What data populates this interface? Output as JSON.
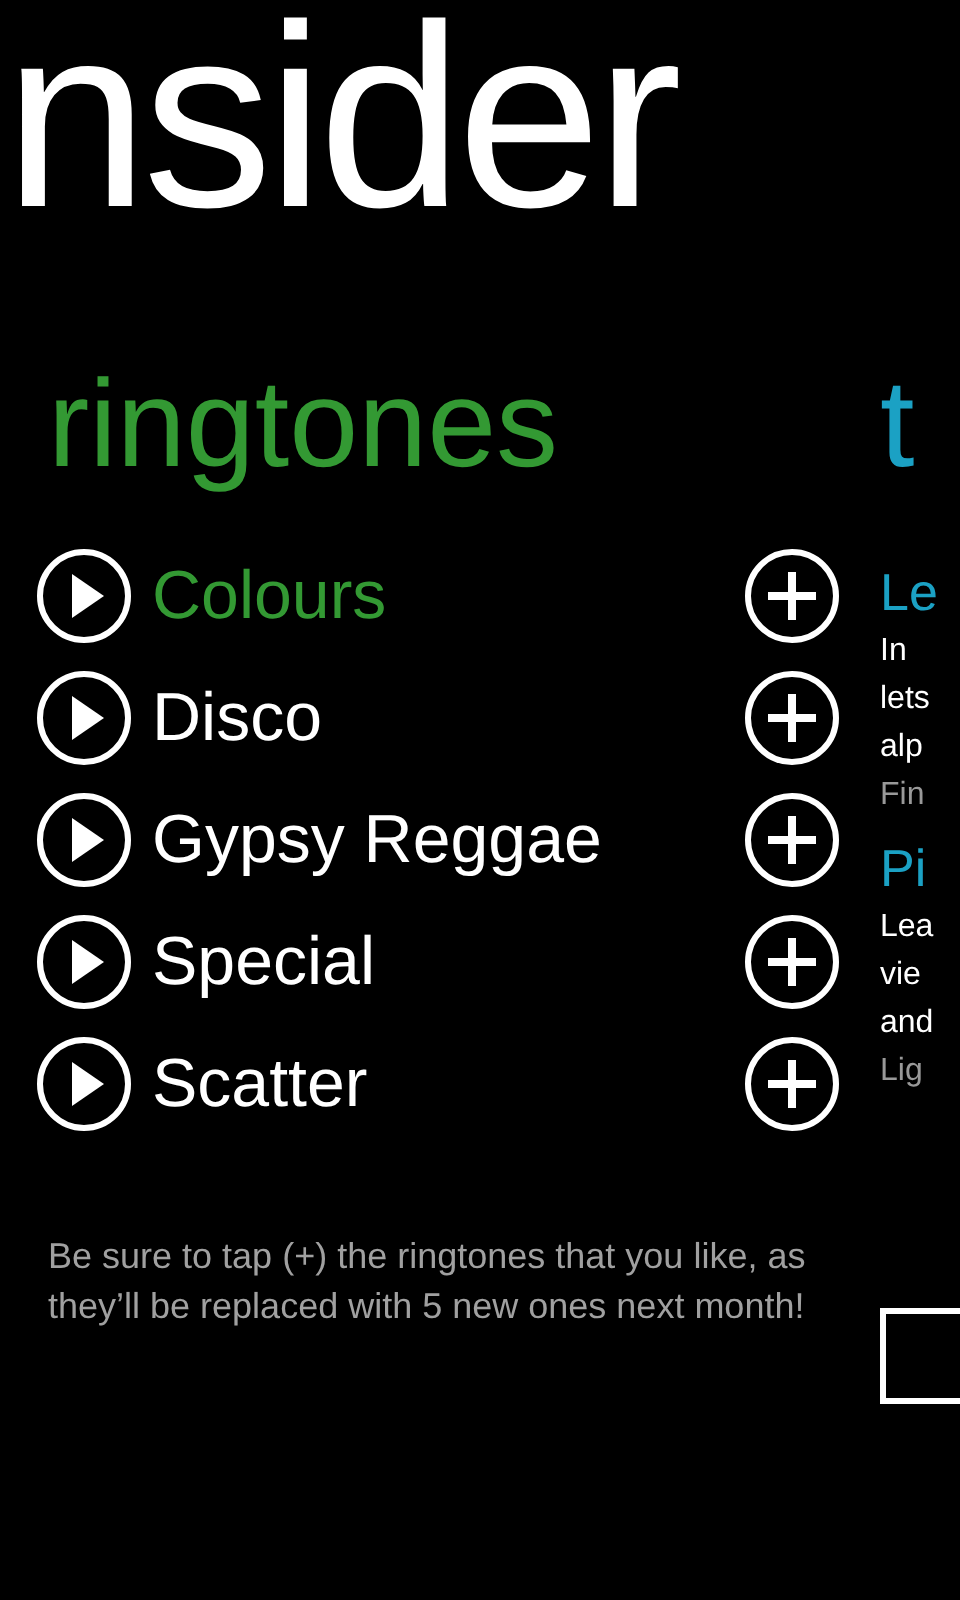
{
  "app_title": "nsider",
  "ringtones": {
    "heading": "ringtones",
    "items": [
      {
        "name": "Colours",
        "selected": true
      },
      {
        "name": "Disco",
        "selected": false
      },
      {
        "name": "Gypsy Reggae",
        "selected": false
      },
      {
        "name": "Special",
        "selected": false
      },
      {
        "name": "Scatter",
        "selected": false
      }
    ],
    "note": "Be sure to tap (+) the ringtones that you like, as they’ll be replaced with 5 new ones next month!"
  },
  "next_panel": {
    "heading": "t",
    "articles": [
      {
        "title": "Le",
        "lines": [
          "In",
          "lets",
          "alp"
        ],
        "meta": "Fin"
      },
      {
        "title": "Pi",
        "lines": [
          "Lea",
          "vie",
          "and"
        ],
        "meta": "Lig"
      }
    ]
  }
}
